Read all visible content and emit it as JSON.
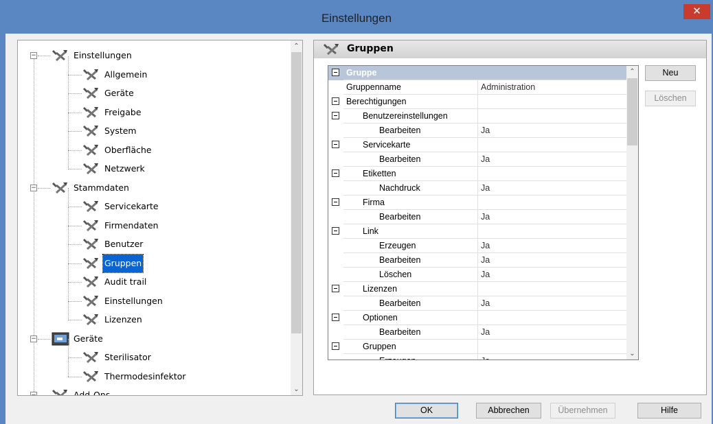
{
  "window": {
    "title": "Einstellungen",
    "close_glyph": "✕"
  },
  "tree": {
    "items": [
      {
        "label": "Einstellungen",
        "level": 0,
        "icon": "tools-icon",
        "expander": "−"
      },
      {
        "label": "Allgemein",
        "level": 1,
        "icon": "tools-icon"
      },
      {
        "label": "Geräte",
        "level": 1,
        "icon": "tools-icon"
      },
      {
        "label": "Freigabe",
        "level": 1,
        "icon": "tools-icon"
      },
      {
        "label": "System",
        "level": 1,
        "icon": "tools-icon"
      },
      {
        "label": "Oberfläche",
        "level": 1,
        "icon": "tools-icon"
      },
      {
        "label": "Netzwerk",
        "level": 1,
        "icon": "tools-icon"
      },
      {
        "label": "Stammdaten",
        "level": 0,
        "icon": "tools-icon",
        "expander": "−"
      },
      {
        "label": "Servicekarte",
        "level": 1,
        "icon": "tools-icon"
      },
      {
        "label": "Firmendaten",
        "level": 1,
        "icon": "tools-icon"
      },
      {
        "label": "Benutzer",
        "level": 1,
        "icon": "tools-icon"
      },
      {
        "label": "Gruppen",
        "level": 1,
        "icon": "tools-icon",
        "selected": true
      },
      {
        "label": "Audit trail",
        "level": 1,
        "icon": "tools-icon"
      },
      {
        "label": "Einstellungen",
        "level": 1,
        "icon": "tools-icon"
      },
      {
        "label": "Lizenzen",
        "level": 1,
        "icon": "tools-icon"
      },
      {
        "label": "Geräte",
        "level": 0,
        "icon": "monitor-icon",
        "expander": "−"
      },
      {
        "label": "Sterilisator",
        "level": 1,
        "icon": "tools-icon"
      },
      {
        "label": "Thermodesinfektor",
        "level": 1,
        "icon": "tools-icon"
      },
      {
        "label": "Add-Ons",
        "level": 0,
        "icon": "tools-icon",
        "expander": "−"
      }
    ]
  },
  "panel": {
    "title": "Gruppen"
  },
  "grid": {
    "rows": [
      {
        "type": "cat",
        "name": "Gruppe",
        "value": "",
        "indent": 0
      },
      {
        "type": "prop",
        "name": "Gruppenname",
        "value": "Administration",
        "indent": 0
      },
      {
        "type": "group",
        "name": "Berechtigungen",
        "value": "",
        "indent": 0
      },
      {
        "type": "group",
        "name": "Benutzereinstellungen",
        "value": "",
        "indent": 1
      },
      {
        "type": "prop",
        "name": "Bearbeiten",
        "value": "Ja",
        "indent": 2
      },
      {
        "type": "group",
        "name": "Servicekarte",
        "value": "",
        "indent": 1
      },
      {
        "type": "prop",
        "name": "Bearbeiten",
        "value": "Ja",
        "indent": 2
      },
      {
        "type": "group",
        "name": "Etiketten",
        "value": "",
        "indent": 1
      },
      {
        "type": "prop",
        "name": "Nachdruck",
        "value": "Ja",
        "indent": 2
      },
      {
        "type": "group",
        "name": "Firma",
        "value": "",
        "indent": 1
      },
      {
        "type": "prop",
        "name": "Bearbeiten",
        "value": "Ja",
        "indent": 2
      },
      {
        "type": "group",
        "name": "Link",
        "value": "",
        "indent": 1
      },
      {
        "type": "prop",
        "name": "Erzeugen",
        "value": "Ja",
        "indent": 2
      },
      {
        "type": "prop",
        "name": "Bearbeiten",
        "value": "Ja",
        "indent": 2
      },
      {
        "type": "prop",
        "name": "Löschen",
        "value": "Ja",
        "indent": 2
      },
      {
        "type": "group",
        "name": "Lizenzen",
        "value": "",
        "indent": 1
      },
      {
        "type": "prop",
        "name": "Bearbeiten",
        "value": "Ja",
        "indent": 2
      },
      {
        "type": "group",
        "name": "Optionen",
        "value": "",
        "indent": 1
      },
      {
        "type": "prop",
        "name": "Bearbeiten",
        "value": "Ja",
        "indent": 2
      },
      {
        "type": "group",
        "name": "Gruppen",
        "value": "",
        "indent": 1
      },
      {
        "type": "prop",
        "name": "Erzeugen",
        "value": "Ja",
        "indent": 2
      }
    ]
  },
  "side_buttons": {
    "new": "Neu",
    "delete": "Löschen"
  },
  "footer": {
    "ok": "OK",
    "cancel": "Abbrechen",
    "apply": "Übernehmen",
    "help": "Hilfe"
  },
  "scroll": {
    "up": "⌃",
    "down": "⌄"
  },
  "colors": {
    "titlebar": "#5a87c2",
    "close": "#c83c2e",
    "selection": "#0a64d2",
    "category": "#b9c6d9"
  }
}
